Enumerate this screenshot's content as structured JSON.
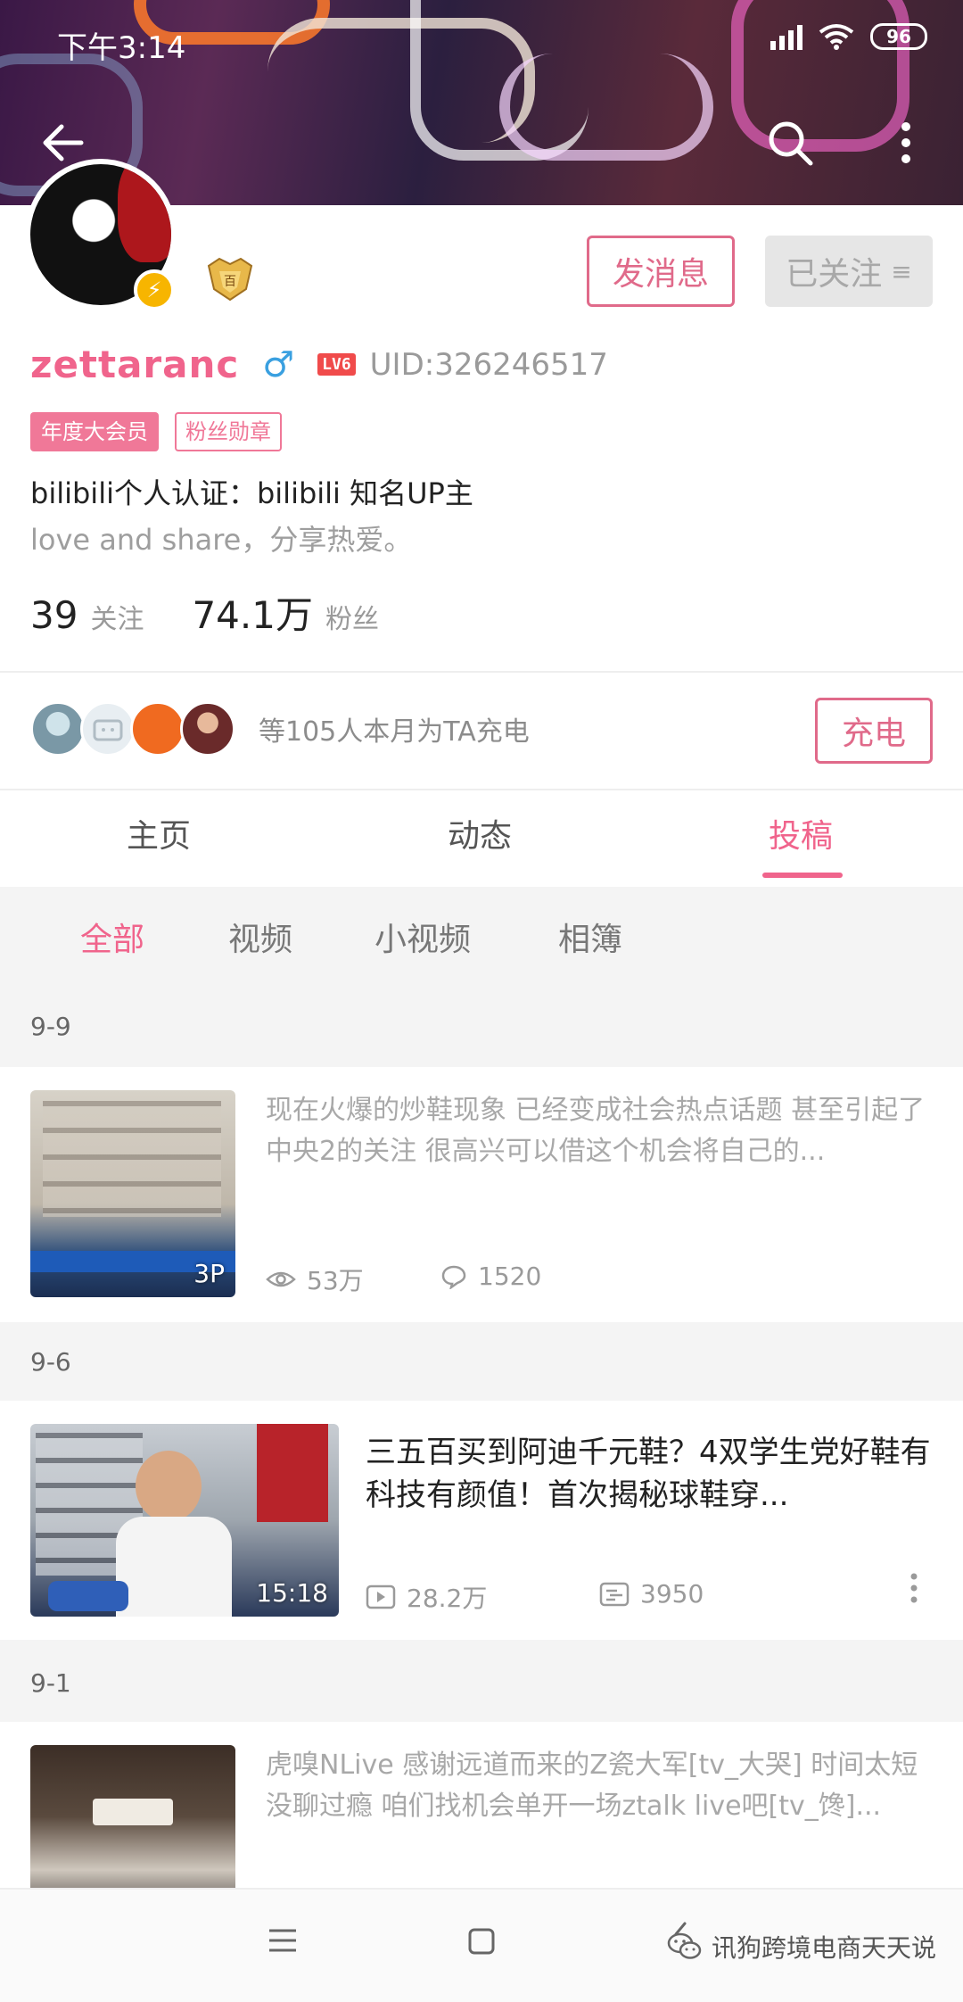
{
  "status": {
    "time": "下午3:14",
    "battery": "96"
  },
  "profile": {
    "username": "zettaranc",
    "gender_symbol": "♂",
    "level": "LV6",
    "uid": "UID:326246517",
    "tags": [
      "年度大会员",
      "粉丝勋章"
    ],
    "certification": "bilibili个人认证：bilibili 知名UP主",
    "bio": "love and share，分享热爱。",
    "following_count": "39",
    "following_label": "关注",
    "fans_count": "74.1万",
    "fans_label": "粉丝",
    "message_button": "发消息",
    "followed_button": "已关注",
    "followed_menu_symbol": "≡"
  },
  "charge": {
    "text": "等105人本月为TA充电",
    "button": "充电"
  },
  "tabs": [
    {
      "label": "主页",
      "active": false
    },
    {
      "label": "动态",
      "active": false
    },
    {
      "label": "投稿",
      "active": true
    }
  ],
  "subtabs": [
    {
      "label": "全部",
      "active": true
    },
    {
      "label": "视频",
      "active": false
    },
    {
      "label": "小视频",
      "active": false
    },
    {
      "label": "相簿",
      "active": false
    }
  ],
  "feed": [
    {
      "date": "9-9",
      "type": "album",
      "text": "现在火爆的炒鞋现象 已经变成社会热点话题 甚至引起了中央2的关注 很高兴可以借这个机会将自己的...",
      "thumb_badge": "3P",
      "views": "53万",
      "comments": "1520"
    },
    {
      "date": "9-6",
      "type": "video",
      "title": "三五百买到阿迪千元鞋？4双学生党好鞋有科技有颜值！首次揭秘球鞋穿...",
      "duration": "15:18",
      "plays": "28.2万",
      "danmaku": "3950"
    },
    {
      "date": "9-1",
      "type": "album",
      "text": "虎嗅NLive 感谢远道而来的Z瓷大军[tv_大哭] 时间太短没聊过瘾 咱们找机会单开一场ztalk live吧[tv_馋]..."
    }
  ],
  "watermark": "讯狗跨境电商天天说",
  "colors": {
    "accent": "#f0648c",
    "gender": "#3aa0e0",
    "level": "#f04b4b"
  },
  "icons": [
    "back-arrow-icon",
    "search-icon",
    "more-vertical-icon",
    "eye-icon",
    "comment-icon",
    "play-icon",
    "danmaku-icon",
    "menu-icon",
    "home-square-icon",
    "back-nav-icon",
    "wechat-icon"
  ]
}
